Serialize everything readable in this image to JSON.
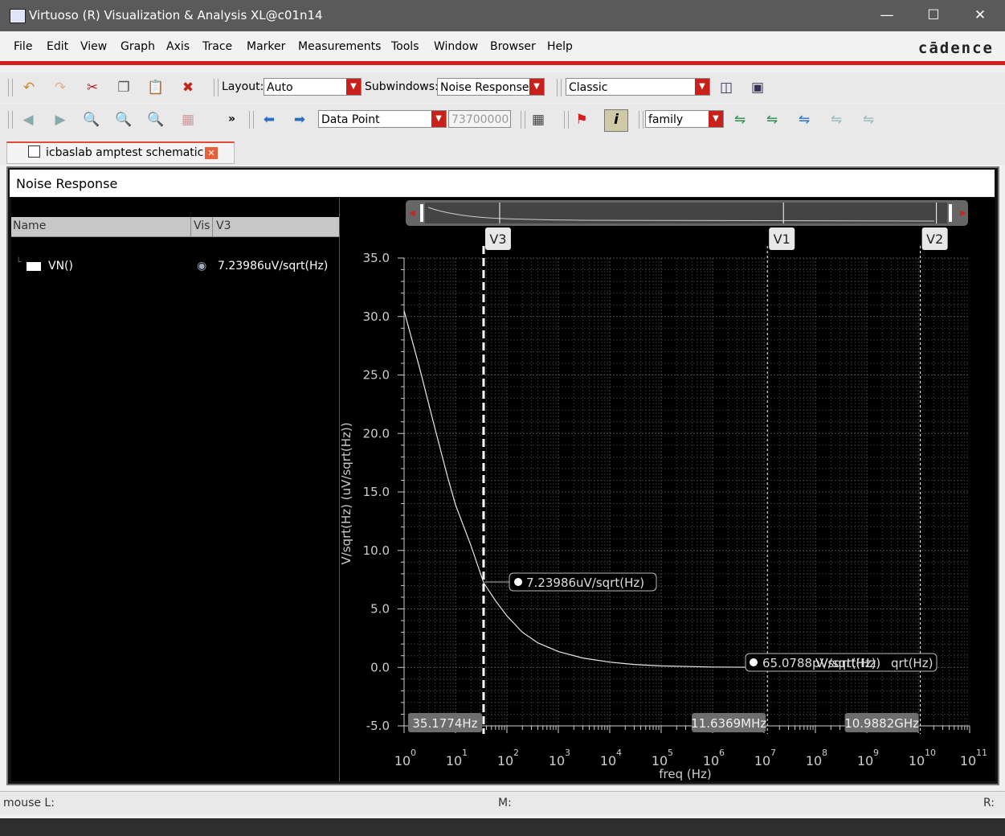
{
  "window": {
    "title": "Virtuoso (R) Visualization & Analysis XL@c01n14",
    "logo": "cādence"
  },
  "menu": [
    "File",
    "Edit",
    "View",
    "Graph",
    "Axis",
    "Trace",
    "Marker",
    "Measurements",
    "Tools",
    "Window",
    "Browser",
    "Help"
  ],
  "toolbar1": {
    "layout_label": "Layout:",
    "layout_value": "Auto",
    "subwindows_label": "Subwindows:",
    "subwindows_value": "Noise Response",
    "style_value": "Classic"
  },
  "toolbar2": {
    "more": "»",
    "marker_type": "Data Point",
    "marker_value": "73700000",
    "family_value": "family"
  },
  "tab": {
    "label": "icbaslab amptest schematic"
  },
  "graph": {
    "title": "Noise Response"
  },
  "trace_table": {
    "headers": [
      "Name",
      "Vis",
      "V3"
    ],
    "rows": [
      {
        "name": "VN()",
        "value": "7.23986uV/sqrt(Hz)"
      }
    ]
  },
  "markers": {
    "cursors": [
      {
        "label": "V3",
        "readout": "35.1774Hz",
        "freq": 35.1774
      },
      {
        "label": "V1",
        "readout": "11.6369MHz",
        "freq": 11636900
      },
      {
        "label": "V2",
        "readout": "10.9882GHz",
        "freq": 10988200000
      }
    ],
    "point1": "7.23986uV/sqrt(Hz)",
    "point2": "65.0788pV/sqrt(Hz)",
    "point2_overlap": "V/sqrt(Hz)",
    "point2_tail": "qrt(Hz)"
  },
  "chart_data": {
    "type": "line",
    "xlabel": "freq (Hz)",
    "ylabel": "V/sqrt(Hz) (uV/sqrt(Hz))",
    "xscale": "log",
    "xlim": [
      1,
      100000000000
    ],
    "ylim": [
      -5,
      35
    ],
    "yticks": [
      "35.0",
      "30.0",
      "25.0",
      "20.0",
      "15.0",
      "10.0",
      "5.0",
      "0.0",
      "-5.0"
    ],
    "xticks": [
      "10",
      "10",
      "10",
      "10",
      "10",
      "10",
      "10",
      "10",
      "10",
      "10",
      "10",
      "10"
    ],
    "xtick_exps": [
      "0",
      "1",
      "2",
      "3",
      "4",
      "5",
      "6",
      "7",
      "8",
      "9",
      "10",
      "11"
    ],
    "grid": true,
    "series": [
      {
        "name": "VN()",
        "x": [
          1,
          2,
          4,
          7,
          10,
          20,
          35.18,
          60,
          100,
          200,
          400,
          1000,
          3000,
          10000,
          30000,
          100000,
          1000000,
          10000000,
          11636900
        ],
        "y": [
          30.5,
          25.6,
          20.4,
          16.3,
          13.9,
          10.4,
          7.24,
          5.7,
          4.4,
          3.0,
          2.1,
          1.35,
          0.8,
          0.45,
          0.25,
          0.13,
          0.03,
          0.005,
          6.51e-05
        ]
      }
    ]
  },
  "status": {
    "mouse": "mouse L:",
    "m": "M:",
    "r": "R:"
  }
}
